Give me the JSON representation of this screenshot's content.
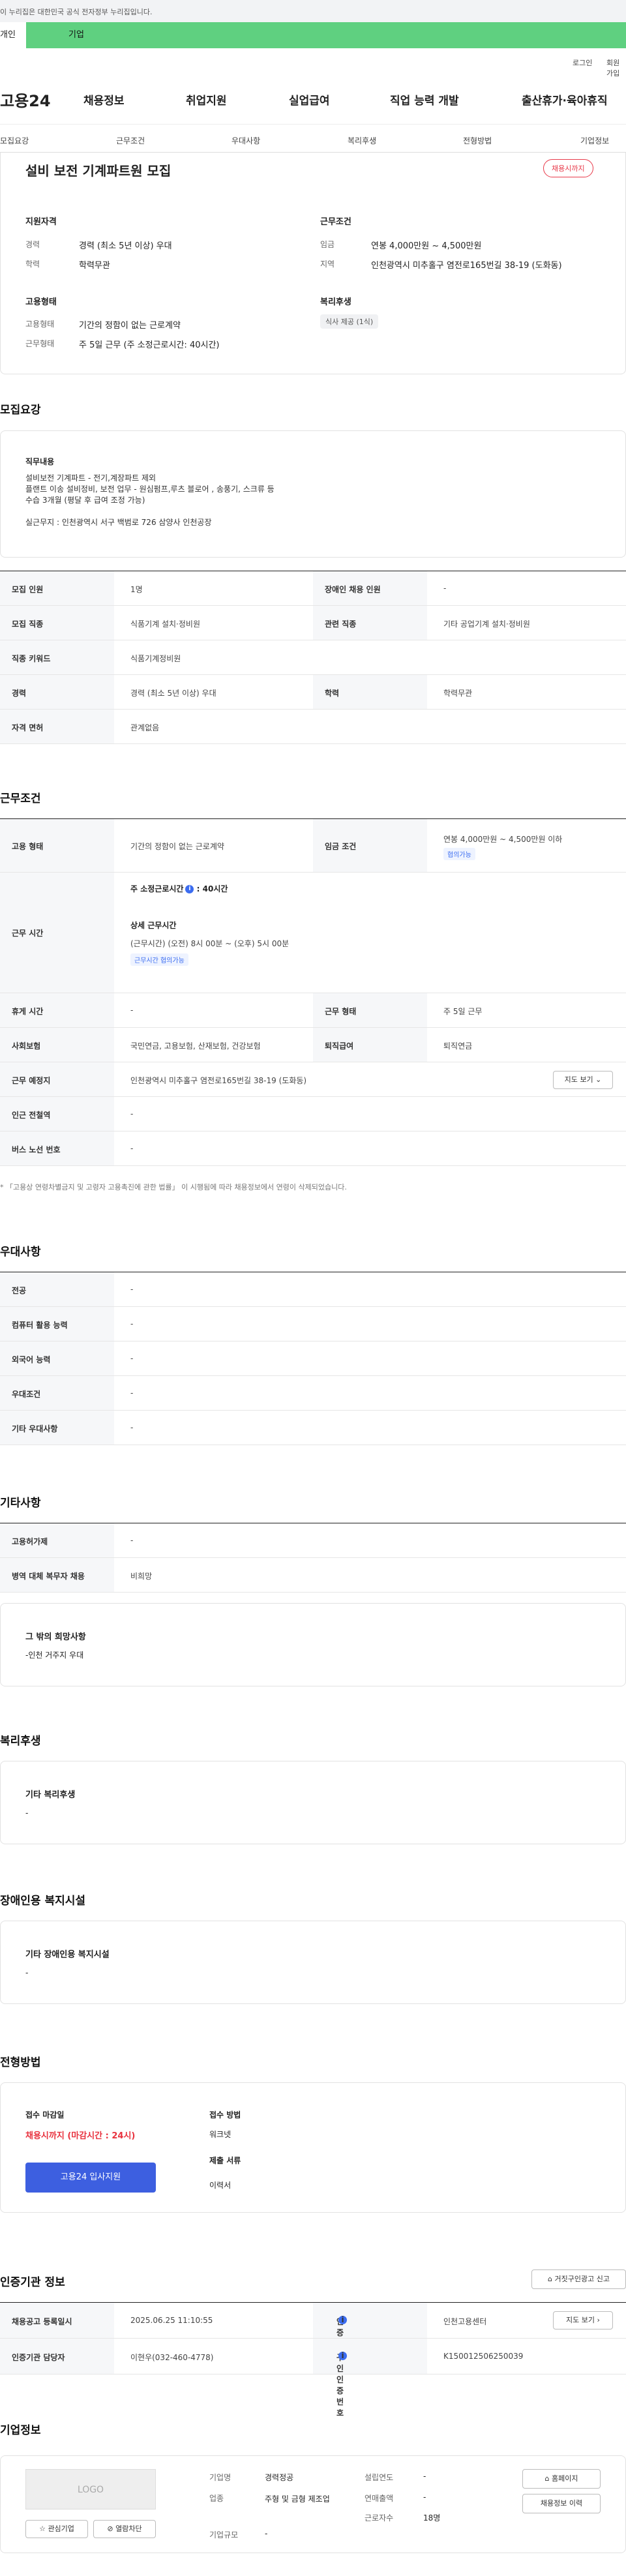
{
  "gov_banner": "이 누리집은 대한민국 공식 전자정부 누리집입니다.",
  "top_tabs": {
    "person": "개인",
    "company": "기업"
  },
  "util": {
    "login": "로그인",
    "join": "회원가입"
  },
  "gnb": {
    "logo": "고용24",
    "items": [
      "채용정보",
      "취업지원",
      "실업급여",
      "직업 능력 개발",
      "출산휴가·육아휴직"
    ]
  },
  "snb": [
    "모집요강",
    "근무조건",
    "우대사항",
    "복리후생",
    "전형방법",
    "기업정보"
  ],
  "summary": {
    "title": "설비 보전 기계파트원 모집",
    "status_badge": "채용시까지",
    "qual_title": "지원자격",
    "qual": [
      {
        "label": "경력",
        "value": "경력 (최소 5년 이상) 우대"
      },
      {
        "label": "학력",
        "value": "학력무관"
      }
    ],
    "work_title": "근무조건",
    "work": [
      {
        "label": "임금",
        "value": "연봉 4,000만원 ~ 4,500만원"
      },
      {
        "label": "지역",
        "value": "인천광역시 미추홀구 염전로165번길 38-19 (도화동)"
      }
    ],
    "emp_title": "고용형태",
    "emp": [
      {
        "label": "고용형태",
        "value": "기간의 정함이 없는 근로계약"
      },
      {
        "label": "근무형태",
        "value": "주 5일 근무 (주 소정근로시간: 40시간)"
      }
    ],
    "welfare_title": "복리후생",
    "welfare_tag": "식사 제공 (1식)"
  },
  "recruit": {
    "section_title": "모집요강",
    "job_desc_title": "직무내용",
    "job_desc_lines": [
      "설비보전 기계파트 - 전기,계장파트 제외",
      "플랜트 이송 설비정비, 보전 업무 - 원심펌프,루츠 블로어 , 송풍기, 스크류 등",
      "수습 3개월 (평달 후 급여 조정 가능)",
      "",
      "실근무지 : 인천광역시 서구 백범로 726 삼양사 인천공장"
    ],
    "rows": [
      {
        "k1": "모집 인원",
        "v1": "1명",
        "k2": "장애인 채용 인원",
        "v2": "-"
      },
      {
        "k1": "모집 직종",
        "v1": "식품기계 설치·정비원",
        "k2": "관련 직종",
        "v2": "기타 공업기계 설치·정비원"
      },
      {
        "k1": "직종 키워드",
        "v1": "식품기계정비원"
      },
      {
        "k1": "경력",
        "v1": "경력 (최소 5년 이상) 우대",
        "k2": "학력",
        "v2": "학력무관"
      },
      {
        "k1": "자격 면허",
        "v1": "관계없음"
      }
    ]
  },
  "work_cond": {
    "section_title": "근무조건",
    "emp_type_label": "고용 형태",
    "emp_type_value": "기간의 정함이 없는 근로계약",
    "wage_label": "임금 조건",
    "wage_value": "연봉 4,000만원 ~ 4,500만원 이하",
    "wage_tag": "협의가능",
    "hours_label": "근무 시간",
    "hours_main": "주 소정근로시간",
    "hours_main_value": ": 40시간",
    "hours_detail_title": "상세 근무시간",
    "hours_detail": "(근무시간) (오전) 8시 00분 ~ (오후) 5시 00분",
    "hours_tag": "근무시간 협의가능",
    "holiday_label": "휴게 시간",
    "holiday_value": "-",
    "work_form_label": "근무 형태",
    "work_form_value": "주 5일 근무",
    "insurance_label": "사회보험",
    "insurance_value": "국민연금, 고용보험, 산재보험, 건강보험",
    "retire_label": "퇴직급여",
    "retire_value": "퇴직연금",
    "place_label": "근무 예정지",
    "place_value": "인천광역시 미추홀구 염전로165번길 38-19 (도화동)",
    "map_btn": "지도 보기",
    "subway_label": "인근 전철역",
    "subway_value": "-",
    "bus_label": "버스 노선 번호",
    "bus_value": "-",
    "note": "* 「고용상 연령차별금지 및 고령자 고용촉진에 관한 법률」 이 시행됨에 따라 채용정보에서 연령이 삭제되었습니다."
  },
  "prefer": {
    "section_title": "우대사항",
    "rows": [
      {
        "k": "전공",
        "v": "-"
      },
      {
        "k": "컴퓨터 활용 능력",
        "v": "-"
      },
      {
        "k": "외국어 능력",
        "v": "-"
      },
      {
        "k": "우대조건",
        "v": "-"
      },
      {
        "k": "기타 우대사항",
        "v": "-"
      }
    ]
  },
  "etc": {
    "section_title": "기타사항",
    "rows": [
      {
        "k": "고용허가제",
        "v": "-"
      },
      {
        "k": "병역 대체 복무자 채용",
        "v": "비희망"
      }
    ],
    "box_title": "그 밖의 희망사항",
    "box_value": "-인천 거주지 우대"
  },
  "welfare": {
    "section_title": "복리후생",
    "box_title": "기타 복리후생",
    "box_value": "-"
  },
  "disabled": {
    "section_title": "장애인용 복지시설",
    "box_title": "기타 장애인용 복지시설",
    "box_value": "-"
  },
  "select": {
    "section_title": "전형방법",
    "deadline_label": "접수 마감일",
    "deadline_value": "채용시까지 (마감시간 : 24시)",
    "apply_btn": "고용24 입사지원",
    "method_label": "접수 방법",
    "method_value": "워크넷",
    "docs_label": "제출 서류",
    "docs_value": "이력서"
  },
  "agency": {
    "section_title": "인증기관 정보",
    "report_btn": "거짓구인광고 신고",
    "reg_label": "채용공고 등록일시",
    "reg_value": "2025.06.25 11:10:55",
    "org_label": "인증기관",
    "org_value": "인천고용센터",
    "map_btn": "지도 보기",
    "mgr_label": "인증기관 담당자",
    "mgr_value": "이현우(032-460-4778)",
    "no_label": "구인인증번호",
    "no_value": "K150012506250039"
  },
  "company": {
    "section_title": "기업정보",
    "logo": "LOGO",
    "fav_btn": "관심기업",
    "block_btn": "열람차단",
    "name_label": "기업명",
    "name_value": "경력정공",
    "industry_label": "업종",
    "industry_value": "주형 및 금형 제조업",
    "size_label": "기업규모",
    "size_value": "-",
    "year_label": "설립연도",
    "year_value": "-",
    "sales_label": "연매출액",
    "sales_value": "-",
    "emp_label": "근로자수",
    "emp_value": "18명",
    "home_btn": "홈페이지",
    "history_btn": "채용정보 이력"
  }
}
